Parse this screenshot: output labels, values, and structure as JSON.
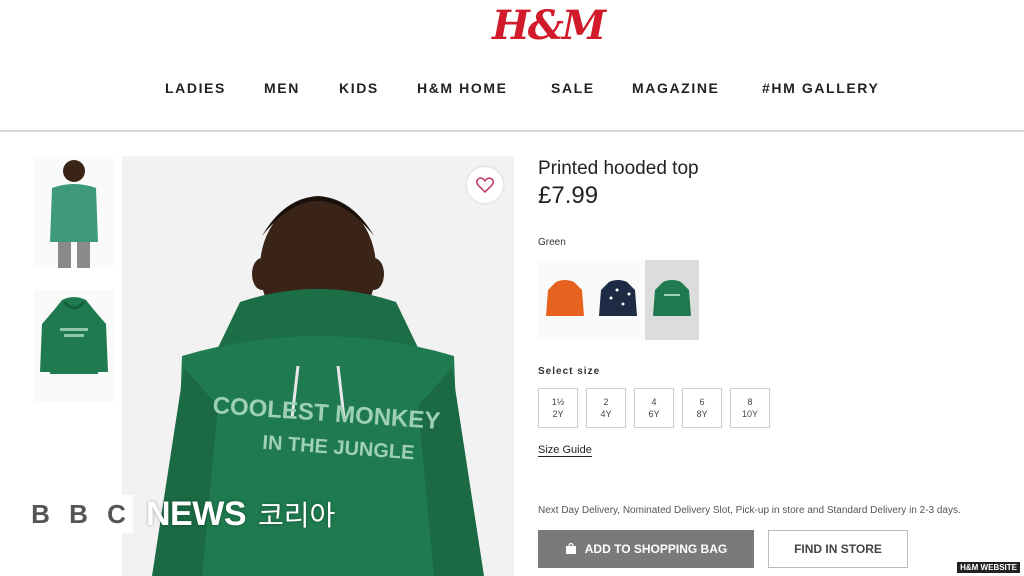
{
  "header": {
    "logo": "H&M",
    "nav": [
      "LADIES",
      "MEN",
      "KIDS",
      "H&M HOME",
      "SALE",
      "MAGAZINE",
      "#HM GALLERY"
    ]
  },
  "gallery": {
    "thumbnails": [
      "thumbnail-model",
      "thumbnail-flat"
    ]
  },
  "product": {
    "name": "Printed hooded top",
    "price": "£7.99",
    "print_line1": "COOLEST MONKEY",
    "print_line2": "IN THE JUNGLE",
    "color_label": "Green",
    "swatches": [
      "#e8621f",
      "#1d2b45",
      "#1f7a4f"
    ],
    "size_label": "Select size",
    "sizes": [
      {
        "l1": "1½",
        "l2": "2Y"
      },
      {
        "l1": "2",
        "l2": "4Y"
      },
      {
        "l1": "4",
        "l2": "6Y"
      },
      {
        "l1": "6",
        "l2": "8Y"
      },
      {
        "l1": "8",
        "l2": "10Y"
      }
    ],
    "size_guide": "Size Guide",
    "delivery": "Next Day Delivery, Nominated Delivery Slot, Pick-up in store and Standard Delivery in 2-3 days.",
    "add_to_bag": "ADD TO SHOPPING BAG",
    "find_in_store": "FIND IN STORE"
  },
  "overlay": {
    "bbc_letters": [
      "B",
      "B",
      "C"
    ],
    "news": "NEWS",
    "korean": "코리아",
    "credit": "H&M WEBSITE"
  },
  "colors": {
    "brand_red": "#d11b2b",
    "hoodie_green": "#1f7a4f",
    "button_grey": "#7a7a7a"
  }
}
